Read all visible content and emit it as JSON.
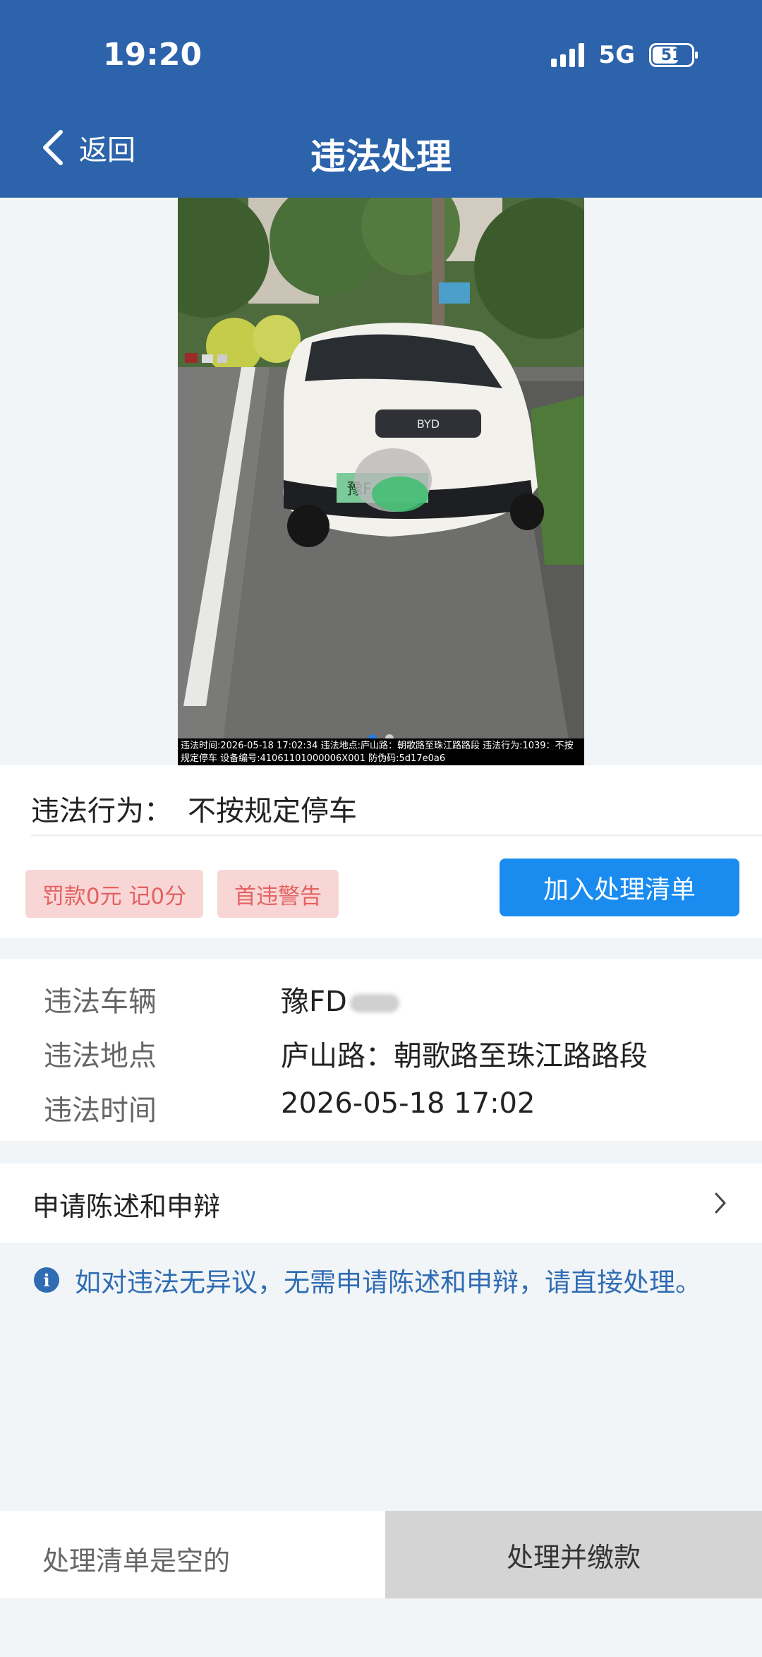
{
  "status_bar": {
    "time": "19:20",
    "network": "5G",
    "battery": "51"
  },
  "nav": {
    "back_label": "返回",
    "title": "违法处理"
  },
  "photo": {
    "caption": "违法时间:2026-05-18 17:02:34 违法地点:庐山路：朝歌路至珠江路路段 违法行为:1039：不按规定停车 设备编号:41061101000006X001 防伪码:5d17e0a6",
    "plate_partial": "豫F·",
    "carousel_active": 1,
    "carousel_total": 2,
    "colors": {
      "active_dot": "#2a7be0",
      "inactive_dot": "#d0d0d0"
    }
  },
  "violation": {
    "behavior_label": "违法行为：",
    "behavior_value": "不按规定停车",
    "tags": [
      "罚款0元 记0分",
      "首违警告"
    ],
    "add_button": "加入处理清单"
  },
  "details": [
    {
      "label": "违法车辆",
      "value": "豫FD"
    },
    {
      "label": "违法地点",
      "value": "庐山路：朝歌路至珠江路路段"
    },
    {
      "label": "违法时间",
      "value": "2026-05-18 17:02"
    }
  ],
  "appeal": {
    "label": "申请陈述和申辩"
  },
  "notice": "如对违法无异议，无需申请陈述和申辩，请直接处理。",
  "bottom": {
    "empty_list": "处理清单是空的",
    "pay_button": "处理并缴款"
  },
  "colors": {
    "header": "#2c63ab",
    "primary_button": "#1a8cf0",
    "tag_bg": "#f9d6d6",
    "tag_text": "#e46161",
    "notice_text": "#2f6cb3"
  }
}
